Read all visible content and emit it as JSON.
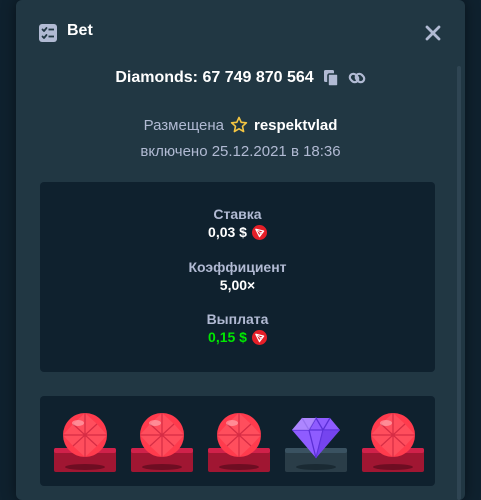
{
  "header": {
    "title": "Bet",
    "icons": {
      "bet": "bet-slip-icon",
      "close": "close-icon"
    }
  },
  "game": {
    "id_text": "Diamonds: 67 749 870 564",
    "icons": {
      "copy": "copy-icon",
      "link": "link-icon"
    }
  },
  "placed": {
    "label": "Размещена",
    "username": "respektvlad",
    "icon": "star-outline-icon"
  },
  "date_text": "включено 25.12.2021 в 18:36",
  "stats": {
    "bet_label": "Ставка",
    "bet_value": "0,03 $",
    "multiplier_label": "Коэффициент",
    "multiplier_value": "5,00×",
    "payout_label": "Выплата",
    "payout_value": "0,15 $",
    "currency_icon": "tron-coin-icon"
  },
  "board": {
    "tiles": [
      {
        "gem": "red"
      },
      {
        "gem": "red"
      },
      {
        "gem": "red"
      },
      {
        "gem": "purple"
      },
      {
        "gem": "red"
      }
    ]
  },
  "colors": {
    "background": "#0f212e",
    "panel": "#213743",
    "text_secondary": "#b1bad3",
    "payout_green": "#00e701",
    "star_yellow": "#f4c542",
    "gem_red": "#ff3b4d",
    "gem_purple": "#8f5cff",
    "tron_red": "#e61f28"
  }
}
